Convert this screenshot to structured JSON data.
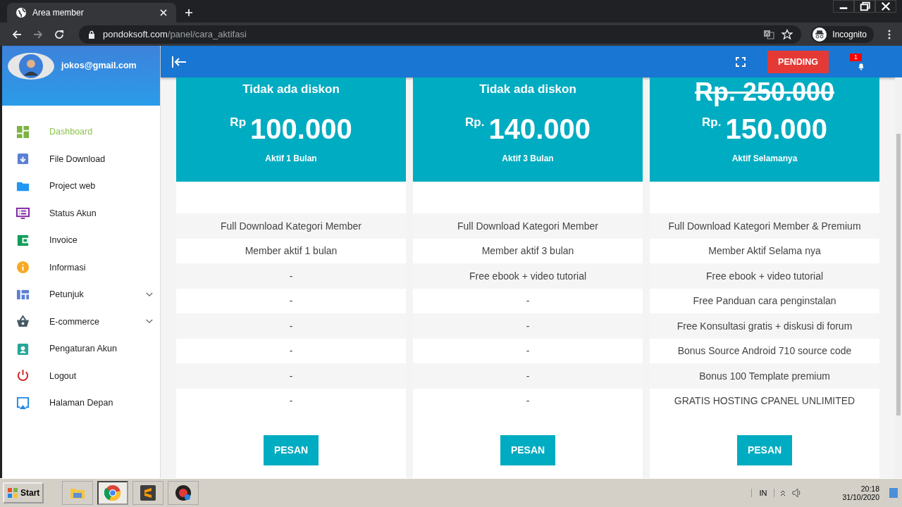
{
  "browser": {
    "tab_title": "Area member",
    "url_host": "pondoksoft.com",
    "url_path": "/panel/cara_aktifasi",
    "profile_label": "Incognito"
  },
  "header": {
    "status_button": "PENDING",
    "notification_count": "1"
  },
  "sidebar": {
    "user_email": "jokos@gmail.com",
    "items": [
      {
        "label": "Dashboard",
        "kind": "dashboard",
        "selected": true,
        "submenu": false
      },
      {
        "label": "File Download",
        "kind": "download",
        "selected": false,
        "submenu": false
      },
      {
        "label": "Project web",
        "kind": "folder",
        "selected": false,
        "submenu": false
      },
      {
        "label": "Status Akun",
        "kind": "list",
        "selected": false,
        "submenu": false
      },
      {
        "label": "Invoice",
        "kind": "wallet",
        "selected": false,
        "submenu": false
      },
      {
        "label": "Informasi",
        "kind": "info",
        "selected": false,
        "submenu": false
      },
      {
        "label": "Petunjuk",
        "kind": "grid",
        "selected": false,
        "submenu": true
      },
      {
        "label": "E-commerce",
        "kind": "basket",
        "selected": false,
        "submenu": true
      },
      {
        "label": "Pengaturan Akun",
        "kind": "badge",
        "selected": false,
        "submenu": false
      },
      {
        "label": "Logout",
        "kind": "power",
        "selected": false,
        "submenu": false
      },
      {
        "label": "Halaman Depan",
        "kind": "airplay",
        "selected": false,
        "submenu": false
      }
    ]
  },
  "plans": [
    {
      "discount_note": "Tidak ada diskon",
      "currency": "Rp",
      "amount": "100.000",
      "duration": "Aktif 1 Bulan",
      "features": [
        "Full Download Kategori Member",
        "Member aktif 1 bulan",
        "-",
        "-",
        "-",
        "-",
        "-",
        "-"
      ],
      "button": "PESAN"
    },
    {
      "discount_note": "Tidak ada diskon",
      "currency": "Rp.",
      "amount": "140.000",
      "duration": "Aktif 3 Bulan",
      "features": [
        "Full Download Kategori Member",
        "Member aktif 3 bulan",
        "Free ebook + video tutorial",
        "-",
        "-",
        "-",
        "-",
        "-"
      ],
      "button": "PESAN"
    },
    {
      "old_price": "Rp. 250.000",
      "currency": "Rp.",
      "amount": "150.000",
      "duration": "Aktif Selamanya",
      "features": [
        "Full Download Kategori Member & Premium",
        "Member Aktif Selama nya",
        "Free ebook + video tutorial",
        "Free Panduan cara penginstalan",
        "Free Konsultasi gratis + diskusi di forum",
        "Bonus Source Android 710 source code",
        "Bonus 100 Template premium",
        "GRATIS HOSTING CPANEL UNLIMITED"
      ],
      "button": "PESAN"
    }
  ],
  "taskbar": {
    "start": "Start",
    "apps": [
      {
        "kind": "folder",
        "selected": false
      },
      {
        "kind": "chrome",
        "selected": true
      },
      {
        "kind": "sublime",
        "selected": false
      },
      {
        "kind": "recorder",
        "selected": false
      }
    ],
    "language": "IN",
    "time": "20:18",
    "date": "31/10/2020"
  }
}
